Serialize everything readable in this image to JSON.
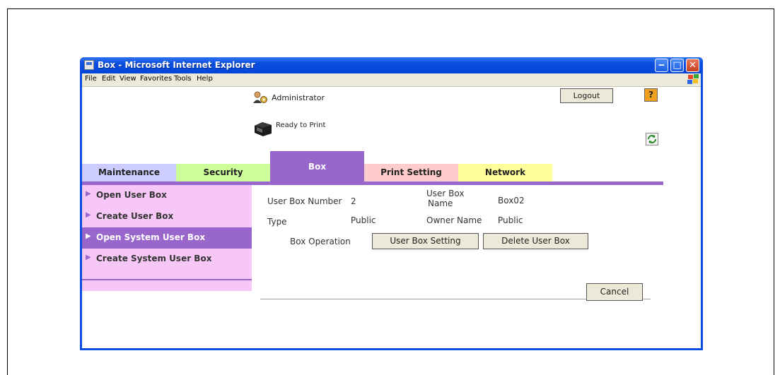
{
  "window": {
    "title": "Box - Microsoft Internet Explorer",
    "minimize_glyph": "‒",
    "maximize_glyph": "□",
    "close_glyph": "✕"
  },
  "menu": {
    "items": [
      "File",
      "Edit",
      "View",
      "Favorites",
      "Tools",
      "Help"
    ]
  },
  "header": {
    "user": "Administrator",
    "logout_label": "Logout",
    "help_label": "?",
    "status": "Ready to Print"
  },
  "tabs": {
    "items": [
      {
        "label": "Maintenance",
        "color": "#ccccff"
      },
      {
        "label": "Security",
        "color": "#ccff99"
      },
      {
        "label": "Box",
        "color": "#9966cc"
      },
      {
        "label": "Print Setting",
        "color": "#ffcccc"
      },
      {
        "label": "Network",
        "color": "#ffff99"
      }
    ],
    "active_index": 2
  },
  "sidebar": {
    "items": [
      {
        "label": "Open User Box"
      },
      {
        "label": "Create User Box"
      },
      {
        "label": "Open System User Box"
      },
      {
        "label": "Create System User Box"
      }
    ],
    "active_index": 2
  },
  "details": {
    "box_number_label": "User Box Number",
    "box_number_value": "2",
    "box_name_label_line1": "User Box",
    "box_name_label_line2": "Name",
    "box_name_value": "Box02",
    "type_label": "Type",
    "type_value": "Public",
    "owner_label": "Owner Name",
    "owner_value": "Public",
    "operation_label": "Box Operation",
    "setting_button": "User Box Setting",
    "delete_button": "Delete User Box",
    "cancel_button": "Cancel"
  },
  "colors": {
    "accent": "#9966cc",
    "sidebar_bg": "#f7c8f7",
    "titlebar": "#0a4de0"
  }
}
